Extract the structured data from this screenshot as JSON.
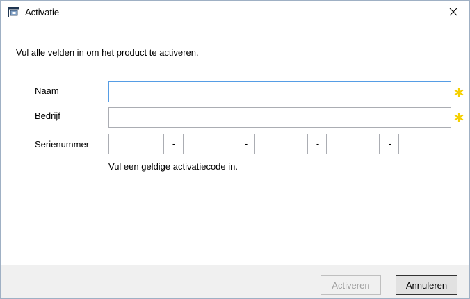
{
  "window": {
    "title": "Activatie",
    "close_glyph": "✕"
  },
  "instruction": "Vul alle velden in om het product te activeren.",
  "form": {
    "name": {
      "label": "Naam",
      "value": "",
      "required": true
    },
    "company": {
      "label": "Bedrijf",
      "value": "",
      "required": true
    },
    "serial": {
      "label": "Serienummer",
      "segments": [
        "",
        "",
        "",
        "",
        ""
      ],
      "separator": "-",
      "hint": "Vul een geldige activatiecode in."
    }
  },
  "buttons": {
    "activate": {
      "label": "Activeren",
      "enabled": false
    },
    "cancel": {
      "label": "Annuleren",
      "enabled": true
    }
  },
  "colors": {
    "required_star": "#f5d000",
    "focus_border": "#569de5",
    "footer_bg": "#f0f0f0",
    "window_border": "#9fb0c4"
  },
  "icons": {
    "app": "window-app-icon",
    "close": "close-icon",
    "required": "asterisk-icon"
  }
}
